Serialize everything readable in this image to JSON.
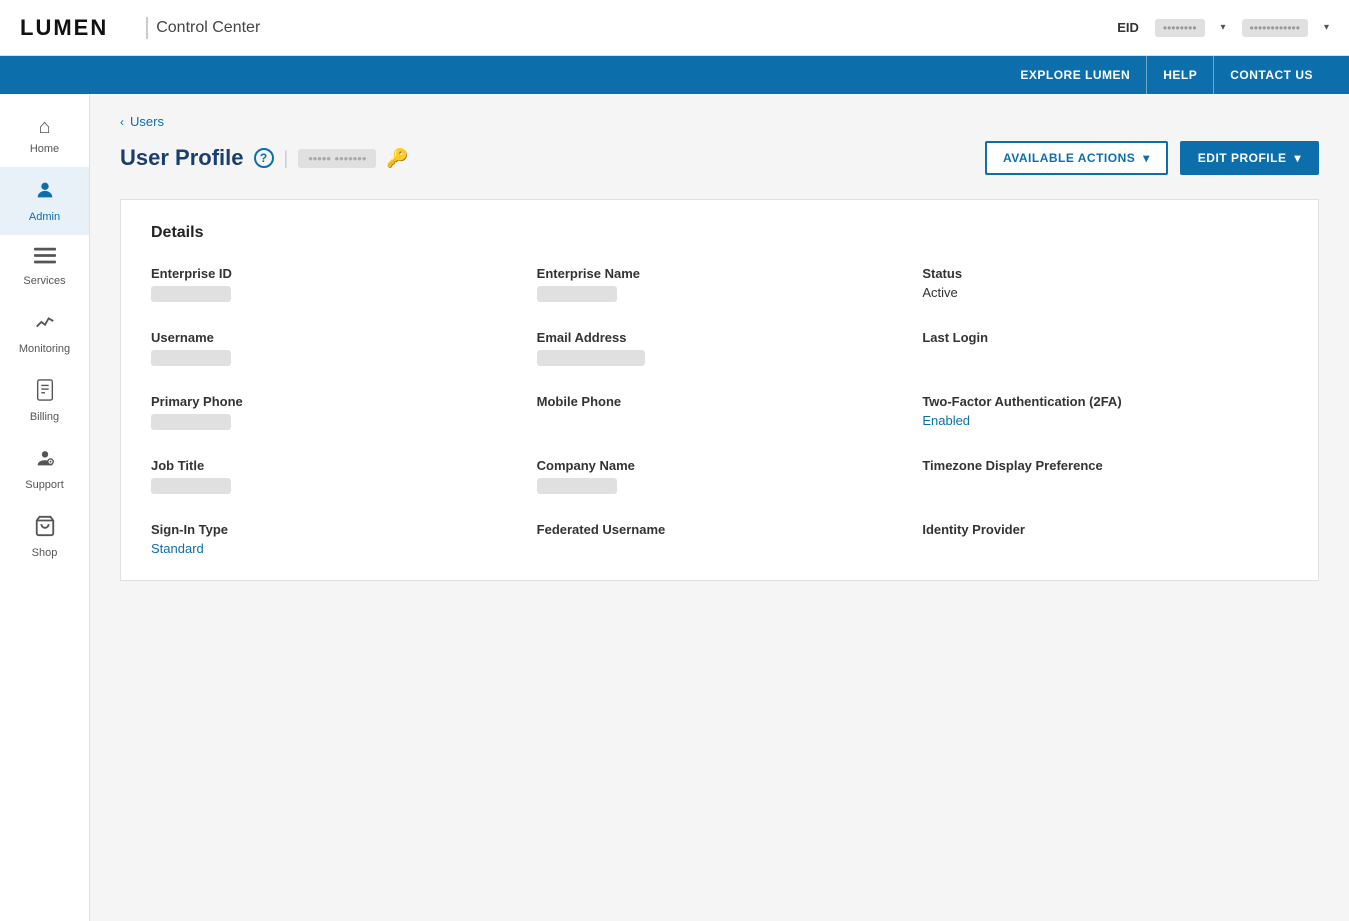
{
  "header": {
    "logo": "LUMEN",
    "app_title": "Control Center",
    "eid_label": "EID",
    "eid_value": "••••••••",
    "user_name": "••••••••••••"
  },
  "blue_nav": {
    "items": [
      {
        "label": "EXPLORE LUMEN"
      },
      {
        "label": "HELP"
      },
      {
        "label": "CONTACT US"
      }
    ]
  },
  "sidebar": {
    "items": [
      {
        "id": "home",
        "label": "Home",
        "icon": "🏠",
        "active": false
      },
      {
        "id": "admin",
        "label": "Admin",
        "icon": "👤",
        "active": true
      },
      {
        "id": "services",
        "label": "Services",
        "icon": "☰",
        "active": false
      },
      {
        "id": "monitoring",
        "label": "Monitoring",
        "icon": "📈",
        "active": false
      },
      {
        "id": "billing",
        "label": "Billing",
        "icon": "📄",
        "active": false
      },
      {
        "id": "support",
        "label": "Support",
        "icon": "⚙",
        "active": false
      },
      {
        "id": "shop",
        "label": "Shop",
        "icon": "🛒",
        "active": false
      }
    ]
  },
  "breadcrumb": {
    "back_label": "Users"
  },
  "page": {
    "title": "User Profile",
    "profile_name": "••••• •••••••",
    "available_actions_label": "AVAILABLE ACTIONS",
    "edit_profile_label": "EDIT PROFILE"
  },
  "details": {
    "section_title": "Details",
    "fields": [
      {
        "label": "Enterprise ID",
        "value": "••••••",
        "type": "blurred"
      },
      {
        "label": "Enterprise Name",
        "value": "•••••",
        "type": "blurred"
      },
      {
        "label": "Status",
        "value": "Active",
        "type": "normal"
      },
      {
        "label": "Username",
        "value": "••••••••••••••",
        "type": "blurred"
      },
      {
        "label": "Email Address",
        "value": "••••••••••••@•••••.•••",
        "type": "blurred"
      },
      {
        "label": "Last Login",
        "value": "",
        "type": "empty"
      },
      {
        "label": "Primary Phone",
        "value": "•••-••-••••",
        "type": "blurred"
      },
      {
        "label": "Mobile Phone",
        "value": "",
        "type": "empty"
      },
      {
        "label": "Two-Factor Authentication (2FA)",
        "value": "Enabled",
        "type": "enabled"
      },
      {
        "label": "Job Title",
        "value": "••••••••••",
        "type": "blurred"
      },
      {
        "label": "Company Name",
        "value": "•••••••",
        "type": "blurred"
      },
      {
        "label": "Timezone Display Preference",
        "value": "",
        "type": "empty"
      },
      {
        "label": "Sign-In Type",
        "value": "Standard",
        "type": "standard"
      },
      {
        "label": "Federated Username",
        "value": "",
        "type": "empty"
      },
      {
        "label": "Identity Provider",
        "value": "",
        "type": "empty"
      }
    ]
  }
}
